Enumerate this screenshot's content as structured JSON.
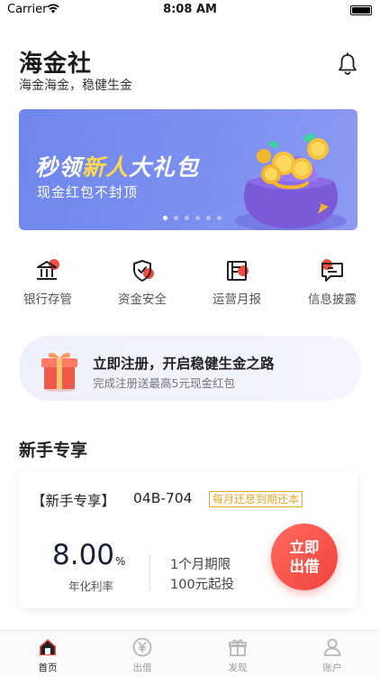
{
  "status_bar": {
    "carrier": "Carrier",
    "time": "8:08 AM"
  },
  "header": {
    "title": "海金社",
    "subtitle": "海金海金，稳健生金",
    "icon": "bell-icon"
  },
  "banner": {
    "title_part1": "秒领",
    "title_highlight": "新人",
    "title_part2": "大礼包",
    "subtitle": "现金红包不封顶",
    "page_count": 6,
    "active_index": 0,
    "colors": {
      "background": "#7c8ff0",
      "highlight": "#ffd84d"
    }
  },
  "quick_nav": [
    {
      "label": "银行存管",
      "icon": "bank-icon"
    },
    {
      "label": "资金安全",
      "icon": "shield-icon"
    },
    {
      "label": "运营月报",
      "icon": "report-icon"
    },
    {
      "label": "信息披露",
      "icon": "message-icon"
    }
  ],
  "promo": {
    "title": "立即注册，开启稳健生金之路",
    "subtitle": "完成注册送最高5元现金红包",
    "icon": "gift-icon"
  },
  "section": {
    "title": "新手专享"
  },
  "product": {
    "tag": "【新手专享】",
    "code": "04B-704",
    "badge": "每月还息到期还本",
    "rate": "8.00",
    "rate_unit": "%",
    "rate_label": "年化利率",
    "term": "1个月期限",
    "min_amount": "100元起投",
    "button_line1": "立即",
    "button_line2": "出借",
    "colors": {
      "accent": "#f0433c",
      "badge": "#e6a72c"
    }
  },
  "tab_bar": [
    {
      "label": "首页",
      "icon": "home-icon",
      "active": true
    },
    {
      "label": "出借",
      "icon": "yen-icon",
      "active": false
    },
    {
      "label": "发现",
      "icon": "gift-box-icon",
      "active": false
    },
    {
      "label": "账户",
      "icon": "user-icon",
      "active": false
    }
  ]
}
